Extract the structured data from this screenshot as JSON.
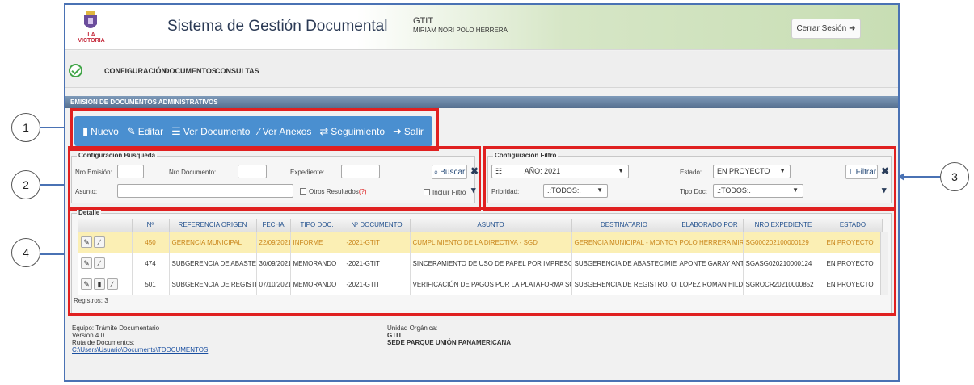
{
  "header": {
    "logo_text": "LA VICTORIA",
    "title": "Sistema de Gestión Documental",
    "org": "GTIT",
    "user": "MIRIAM NORI POLO HERRERA",
    "logout_label": "Cerrar Sesión"
  },
  "menu": [
    "CONFIGURACIÓN",
    "DOCUMENTOS",
    "CONSULTAS"
  ],
  "section_title": "EMISION DE DOCUMENTOS ADMINISTRATIVOS",
  "toolbar": {
    "nuevo": "Nuevo",
    "editar": "Editar",
    "ver_documento": "Ver Documento",
    "ver_anexos": "Ver Anexos",
    "seguimiento": "Seguimiento",
    "salir": "Salir"
  },
  "busqueda": {
    "legend": "Configuración Busqueda",
    "nro_emision": "Nro Emisión:",
    "nro_documento": "Nro Documento:",
    "expediente": "Expediente:",
    "asunto": "Asunto:",
    "otros_resultados": "Otros Resultados",
    "otros_q": "(?)",
    "incluir_filtro": "Incluir Filtro",
    "buscar": "Buscar"
  },
  "filtro": {
    "legend": "Configuración Filtro",
    "anio": "AÑO: 2021",
    "estado_label": "Estado:",
    "estado_value": "EN PROYECTO",
    "prioridad_label": "Prioridad:",
    "prioridad_value": ".:TODOS:.",
    "tipo_doc_label": "Tipo Doc:",
    "tipo_doc_value": ".:TODOS:.",
    "filtrar": "Filtrar"
  },
  "detalle": {
    "legend": "Detalle",
    "columns": [
      "Nº",
      "REFERENCIA ORIGEN",
      "FECHA",
      "TIPO DOC.",
      "Nº DOCUMENTO",
      "ASUNTO",
      "DESTINATARIO",
      "ELABORADO POR",
      "NRO EXPEDIENTE",
      "ESTADO"
    ],
    "rows": [
      [
        "450",
        "GERENCIA MUNICIPAL",
        "22/09/2021",
        "INFORME",
        "-2021-GTIT",
        "CUMPLIMIENTO DE LA DIRECTIVA - SGD",
        "GERENCIA MUNICIPAL - MONTOYA PUE",
        "POLO HERRERA MIRIAM",
        "SG000202100000129",
        "EN PROYECTO"
      ],
      [
        "474",
        "SUBGERENCIA DE ABASTECI",
        "30/09/2021",
        "MEMORANDO",
        "-2021-GTIT",
        "SINCERAMIENTO DE USO DE PAPEL POR IMPRESORA",
        "SUBGERENCIA DE ABASTECIMIENTO Y",
        "APONTE GARAY ANTHO",
        "SGASG020210000124",
        "EN PROYECTO"
      ],
      [
        "501",
        "SUBGERENCIA DE REGISTRO",
        "07/10/2021",
        "MEMORANDO",
        "-2021-GTIT",
        "VERIFICACIÓN DE PAGOS POR LA PLATAFORMA SCOTIABAN",
        "SUBGERENCIA DE REGISTRO, ORIENTA",
        "LOPEZ ROMAN HILDA",
        "SGROCR20210000852",
        "EN PROYECTO"
      ]
    ],
    "registros": "Registros: 3"
  },
  "footer": {
    "equipo": "Equipo: Trámite Documentario",
    "version": "Versión 4.0",
    "ruta_label": "Ruta de Documentos:",
    "ruta_link": "C:\\Users\\Usuario\\Documents\\TDOCUMENTOS",
    "unidad_label": "Unidad Orgánica:",
    "unidad_value": "GTIT",
    "sede": "SEDE PARQUE UNIÓN PANAMERICANA"
  },
  "callouts": [
    "1",
    "2",
    "3",
    "4"
  ],
  "colors": {
    "toolbar": "#4a8fd0",
    "highlight": "#e02020",
    "selected_row": "#fbefb4"
  }
}
